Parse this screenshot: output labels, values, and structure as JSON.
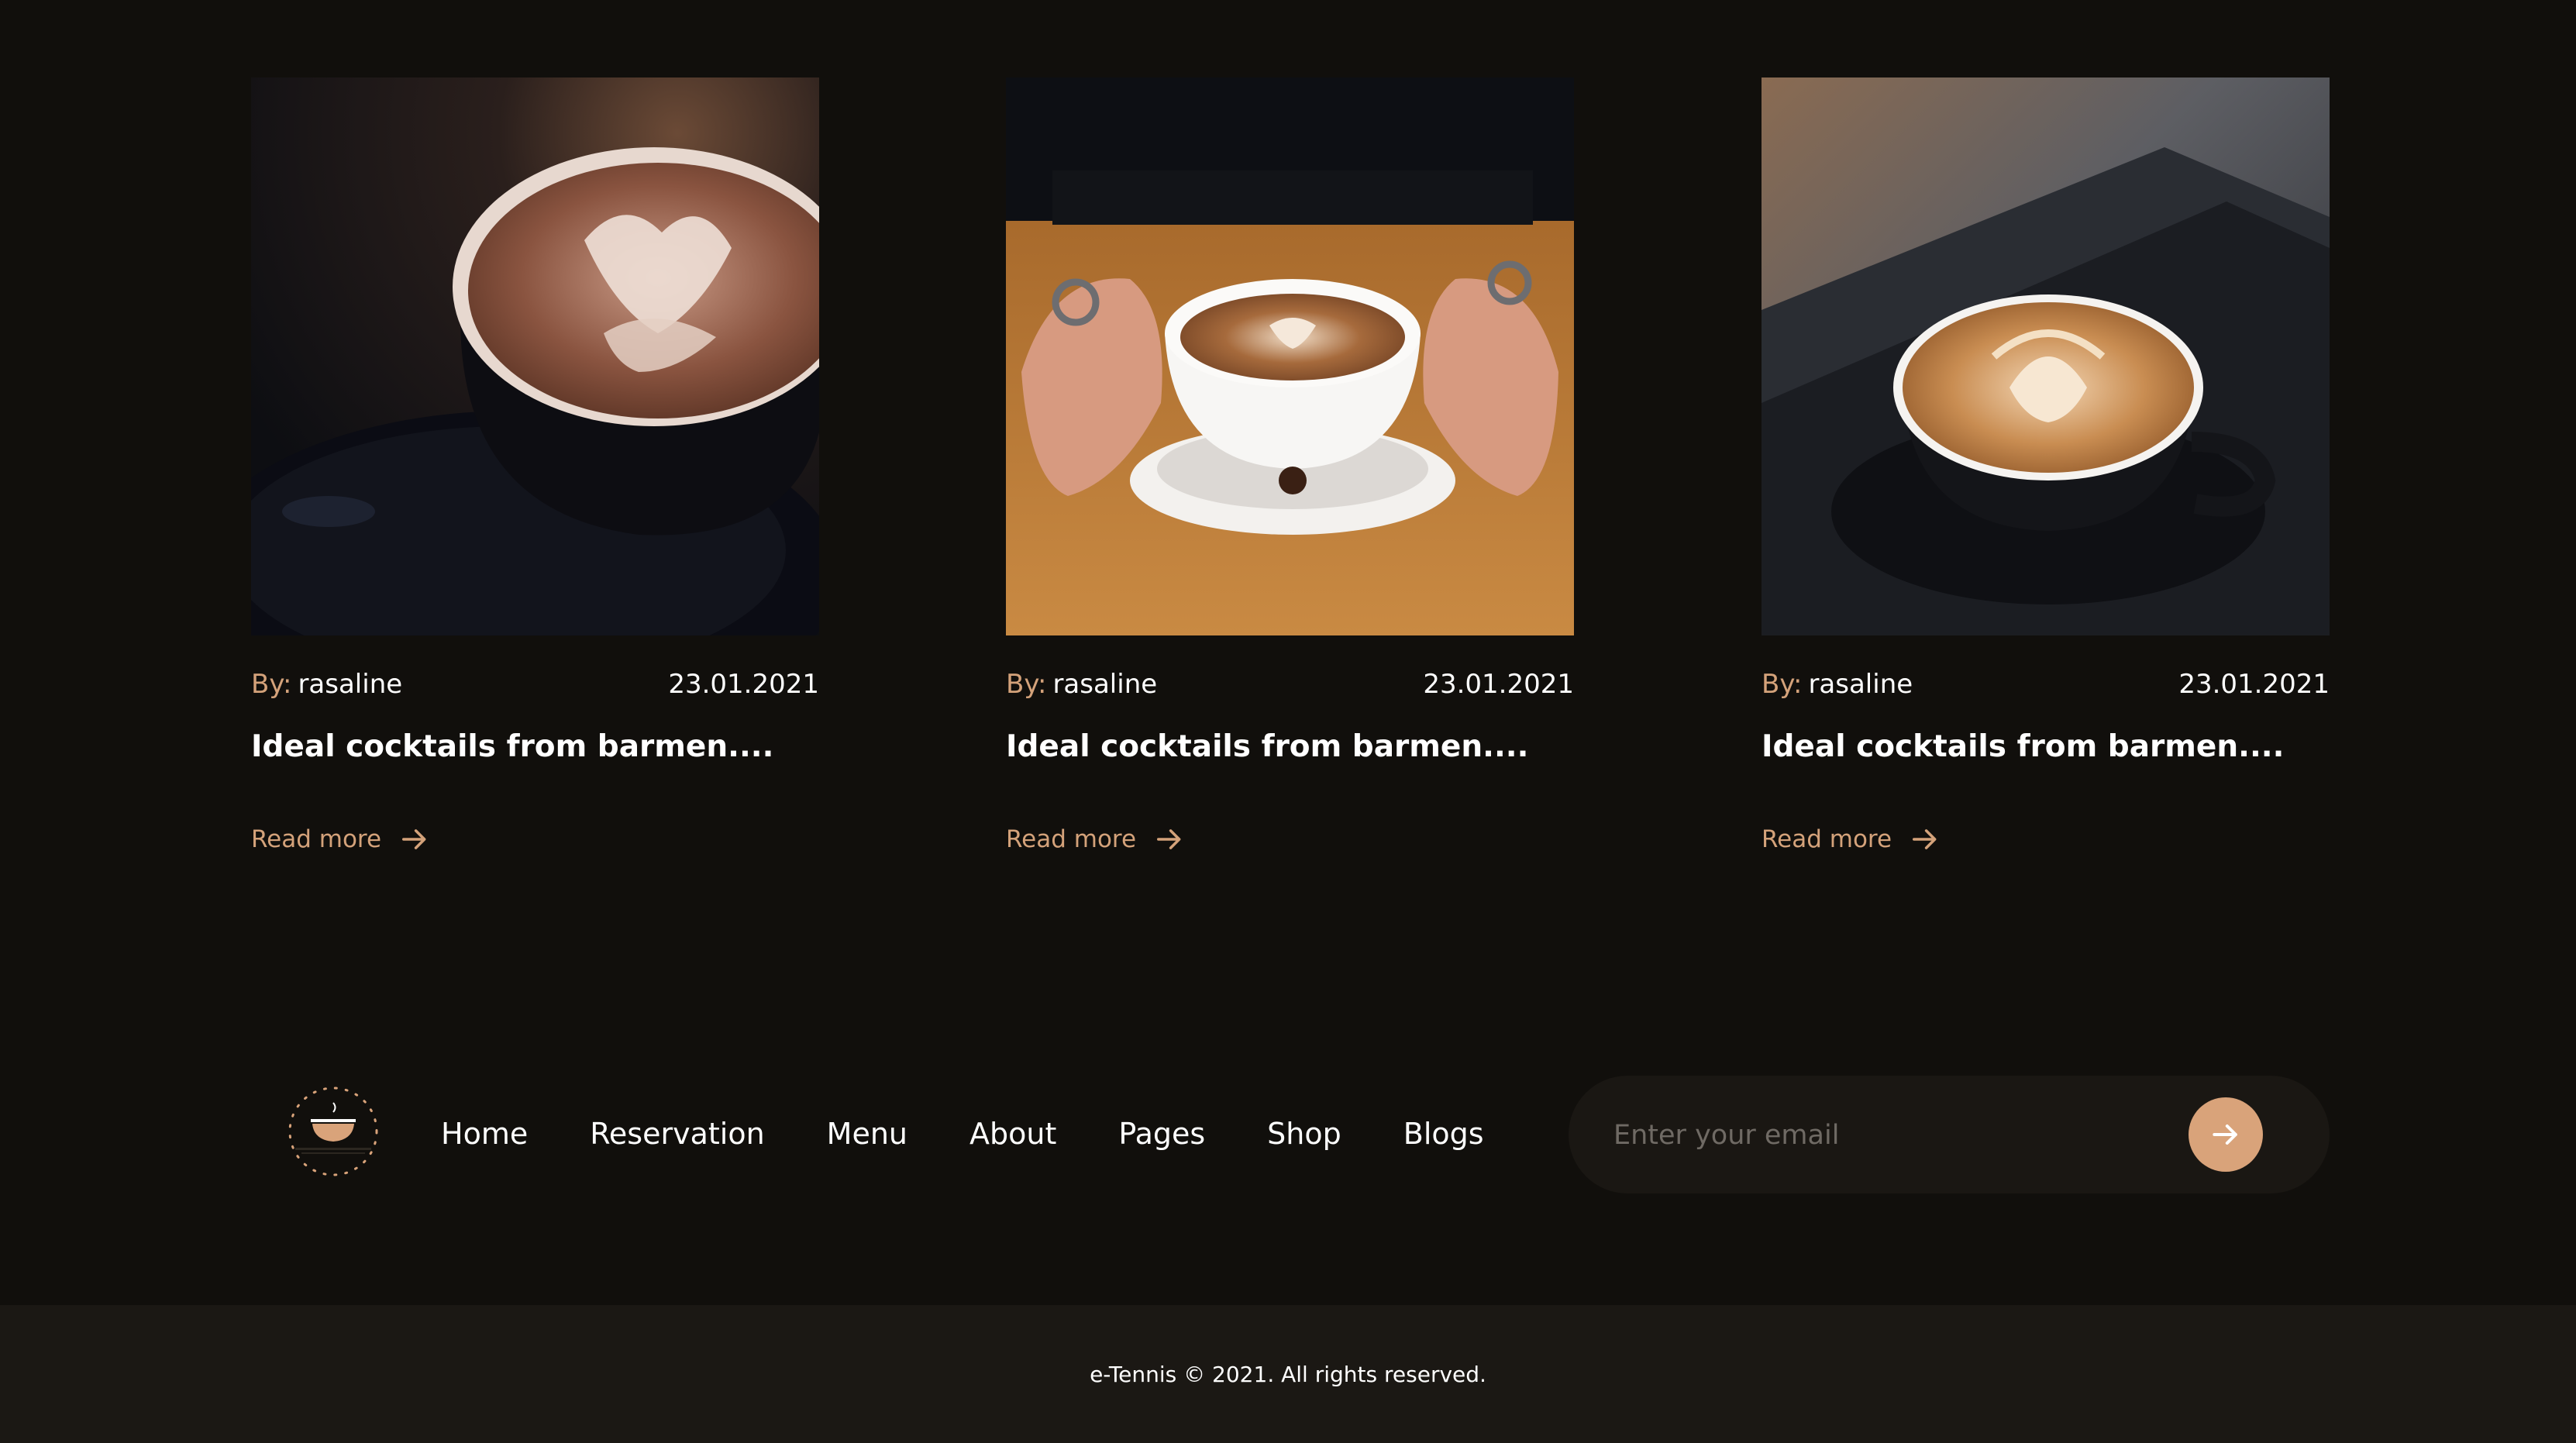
{
  "theme": {
    "background": "#110f0c",
    "accent": "#d4a27a",
    "footer_background": "#1b1814"
  },
  "blog": {
    "posts": [
      {
        "image_alt": "latte art coffee cup on dark saucer",
        "author_prefix": "By:",
        "author": "rasaline",
        "date": "23.01.2021",
        "title": "Ideal cocktails from barmen....",
        "read_more": "Read more",
        "icon": "arrow-right-icon"
      },
      {
        "image_alt": "hands holding latte cup on wooden table",
        "author_prefix": "By:",
        "author": "rasaline",
        "date": "23.01.2021",
        "title": "Ideal cocktails from barmen....",
        "read_more": "Read more",
        "icon": "arrow-right-icon"
      },
      {
        "image_alt": "latte in black cup on dark tray",
        "author_prefix": "By:",
        "author": "rasaline",
        "date": "23.01.2021",
        "title": "Ideal cocktails from barmen....",
        "read_more": "Read more",
        "icon": "arrow-right-icon"
      }
    ]
  },
  "footer": {
    "logo_icon": "coffee-cup-logo-icon",
    "nav": [
      "Home",
      "Reservation",
      "Menu",
      "About",
      "Pages",
      "Shop",
      "Blogs"
    ],
    "email_placeholder": "Enter your email",
    "submit_icon": "arrow-right-icon",
    "copyright": "e-Tennis © 2021. All rights reserved."
  }
}
